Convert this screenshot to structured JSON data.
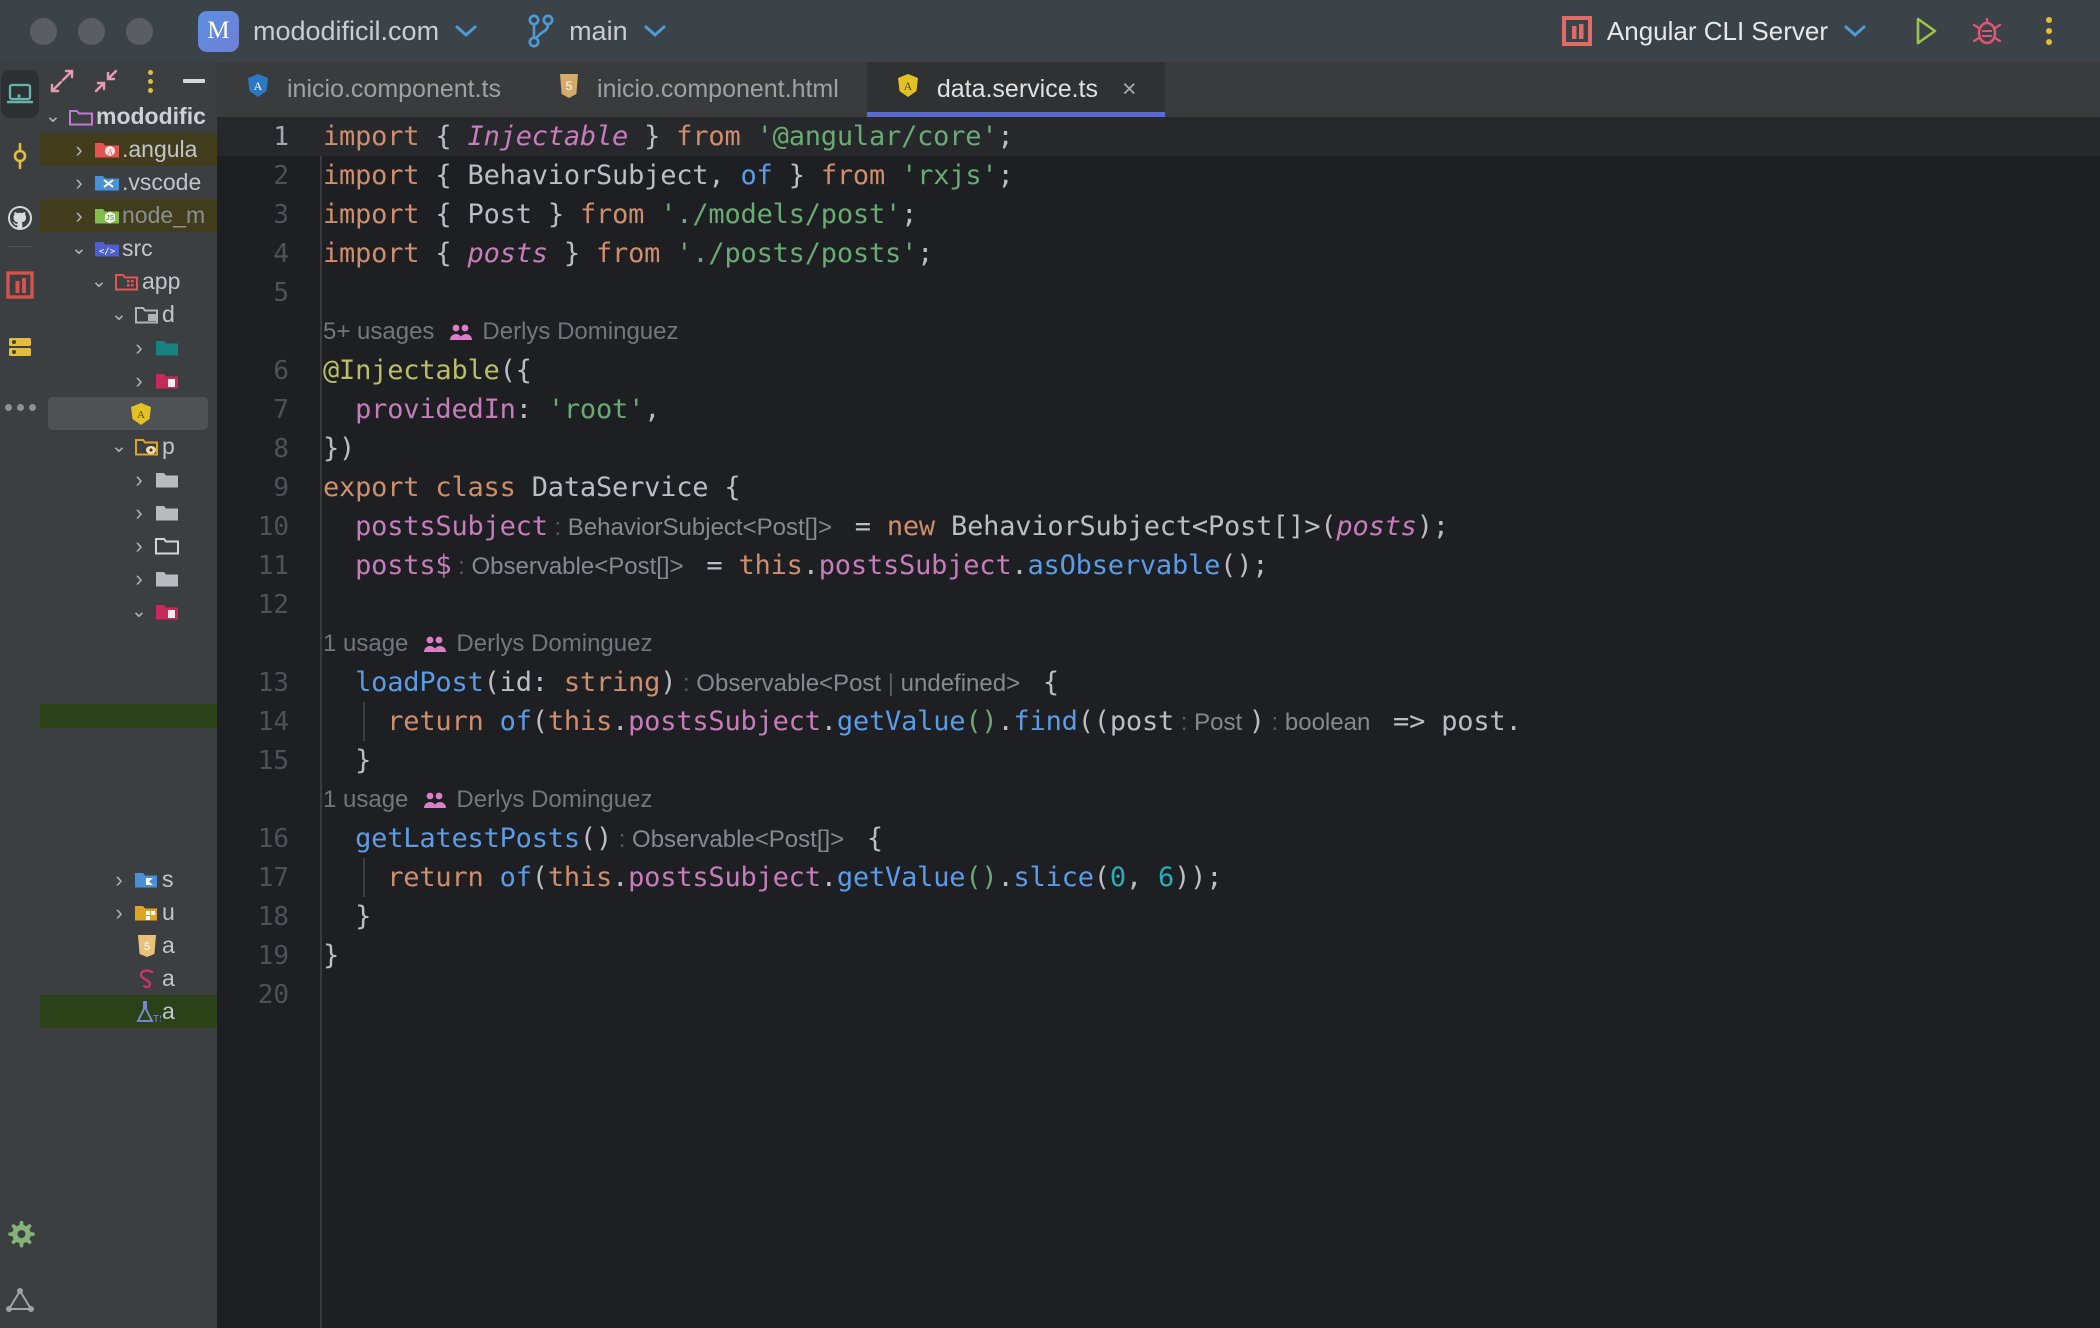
{
  "titlebar": {
    "project_name": "mododificil.com",
    "project_initial": "M",
    "branch": "main",
    "run_config": "Angular CLI Server",
    "run_icon": "angular-run-icon",
    "play_icon": "run-play-icon",
    "debug_icon": "debug-bug-icon",
    "more_icon": "more-vertical-icon"
  },
  "rail": {
    "items": [
      {
        "name": "project-icon",
        "label": "Project"
      },
      {
        "name": "commit-icon",
        "label": "Commit"
      },
      {
        "name": "github-icon",
        "label": "Pull Requests"
      },
      {
        "name": "angular-tool-icon",
        "label": "Angular"
      },
      {
        "name": "database-icon",
        "label": "Database"
      },
      {
        "name": "more-tools-icon",
        "label": "More Tools"
      }
    ],
    "bottom": [
      {
        "name": "settings-gear-icon",
        "label": "Settings"
      },
      {
        "name": "structure-icon",
        "label": "Structure"
      }
    ]
  },
  "project_toolbar": {
    "expand_label": "Expand",
    "collapse_label": "Collapse",
    "options_label": "Options",
    "hide_label": "Hide"
  },
  "tree": [
    {
      "label": "mododific",
      "indent": 0,
      "arrow": "down",
      "icon": "folder-purple-icon",
      "style": "bold",
      "row": "plain"
    },
    {
      "label": ".angula",
      "indent": 1,
      "arrow": "right",
      "icon": "folder-angular-icon",
      "style": "normal",
      "row": "olive"
    },
    {
      "label": ".vscode",
      "indent": 1,
      "arrow": "right",
      "icon": "folder-vscode-icon",
      "style": "normal",
      "row": "plain"
    },
    {
      "label": "node_m",
      "indent": 1,
      "arrow": "right",
      "icon": "folder-node-icon",
      "style": "dim",
      "row": "olive"
    },
    {
      "label": "src",
      "indent": 1,
      "arrow": "down",
      "icon": "folder-source-icon",
      "style": "normal",
      "row": "plain"
    },
    {
      "label": "app",
      "indent": 2,
      "arrow": "down",
      "icon": "folder-app-icon",
      "style": "normal",
      "row": "plain"
    },
    {
      "label": "d",
      "indent": 3,
      "arrow": "down",
      "icon": "folder-data-icon",
      "style": "normal",
      "row": "plain"
    },
    {
      "label": "",
      "indent": 4,
      "arrow": "right",
      "icon": "folder-teal-icon",
      "style": "normal",
      "row": "plain"
    },
    {
      "label": "",
      "indent": 4,
      "arrow": "right",
      "icon": "folder-crimson-icon",
      "style": "normal",
      "row": "plain"
    },
    {
      "label": "",
      "indent": 4,
      "arrow": "none",
      "icon": "angular-file-icon",
      "style": "normal",
      "row": "selected"
    },
    {
      "label": "p",
      "indent": 3,
      "arrow": "down",
      "icon": "folder-yellow-icon",
      "style": "normal",
      "row": "plain"
    },
    {
      "label": "",
      "indent": 4,
      "arrow": "right",
      "icon": "folder-grey-icon",
      "style": "normal",
      "row": "plain"
    },
    {
      "label": "",
      "indent": 4,
      "arrow": "right",
      "icon": "folder-grey-icon",
      "style": "normal",
      "row": "plain"
    },
    {
      "label": "",
      "indent": 4,
      "arrow": "right",
      "icon": "folder-outline-icon",
      "style": "normal",
      "row": "plain"
    },
    {
      "label": "",
      "indent": 4,
      "arrow": "right",
      "icon": "folder-grey-icon",
      "style": "normal",
      "row": "plain"
    },
    {
      "label": "",
      "indent": 4,
      "arrow": "down",
      "icon": "folder-crimson-icon",
      "style": "normal",
      "row": "plain"
    }
  ],
  "tree_green_band": true,
  "tree_bottom": [
    {
      "label": "s",
      "indent": 3,
      "arrow": "right",
      "icon": "folder-shared-icon",
      "row": "plain"
    },
    {
      "label": "u",
      "indent": 3,
      "arrow": "right",
      "icon": "folder-ui-icon",
      "row": "plain"
    },
    {
      "label": "a",
      "indent": 3,
      "arrow": "none",
      "icon": "html5-file-icon",
      "row": "plain"
    },
    {
      "label": "a",
      "indent": 3,
      "arrow": "none",
      "icon": "sass-file-icon",
      "row": "plain"
    },
    {
      "label": "a",
      "indent": 3,
      "arrow": "none",
      "icon": "spec-ts-file-icon",
      "row": "green"
    }
  ],
  "tabs": [
    {
      "label": "inicio.component.ts",
      "icon": "angular-ts-icon",
      "active": false,
      "closable": false
    },
    {
      "label": "inicio.component.html",
      "icon": "html5-icon",
      "active": false,
      "closable": false
    },
    {
      "label": "data.service.ts",
      "icon": "angular-service-icon",
      "active": true,
      "closable": true,
      "close_glyph": "×"
    }
  ],
  "code": {
    "author": "Derlys Dominguez",
    "usages_5": "5+ usages",
    "usages_1": "1 usage",
    "lines": [
      {
        "n": "1",
        "text": "import { Injectable } from '@angular/core';"
      },
      {
        "n": "2",
        "text": "import { BehaviorSubject, of } from 'rxjs';"
      },
      {
        "n": "3",
        "text": "import { Post } from './models/post';"
      },
      {
        "n": "4",
        "text": "import { posts } from './posts/posts';"
      },
      {
        "n": "5",
        "text": ""
      },
      {
        "n": "6",
        "text": "@Injectable({"
      },
      {
        "n": "7",
        "text": "  providedIn: 'root',"
      },
      {
        "n": "8",
        "text": "})"
      },
      {
        "n": "9",
        "text": "export class DataService {"
      },
      {
        "n": "10",
        "text": "  postsSubject : BehaviorSubject<Post[]>  = new BehaviorSubject<Post[]>(posts);"
      },
      {
        "n": "11",
        "text": "  posts$ : Observable<Post[]>  = this.postsSubject.asObservable();"
      },
      {
        "n": "12",
        "text": ""
      },
      {
        "n": "13",
        "text": "  loadPost(id: string) : Observable<Post | undefined>  {"
      },
      {
        "n": "14",
        "text": "    return of(this.postsSubject.getValue().find((post : Post ) : boolean  => post."
      },
      {
        "n": "15",
        "text": "  }"
      },
      {
        "n": "16",
        "text": "  getLatestPosts() : Observable<Post[]>  {"
      },
      {
        "n": "17",
        "text": "    return of(this.postsSubject.getValue().slice(0, 6));"
      },
      {
        "n": "18",
        "text": "  }"
      },
      {
        "n": "19",
        "text": "}"
      },
      {
        "n": "20",
        "text": ""
      }
    ]
  },
  "colors": {
    "titlebar_bg": "#3c4348",
    "panel_bg": "#3c3f41",
    "editor_bg": "#1e1f22",
    "tab_active_bg": "#2f3133",
    "tab_underline": "#5b6ad0",
    "accent_blue": "#4d9ad6",
    "keyword": "#cf8e6d",
    "string": "#6aab73",
    "function": "#5c9ce6",
    "field": "#c77dbb",
    "annotation": "#bcbe67",
    "number": "#2aacb8",
    "hint_grey": "#868a8e",
    "selected_row": "#4e5254",
    "olive_row": "#403c1c",
    "green_row": "#2b4118"
  }
}
